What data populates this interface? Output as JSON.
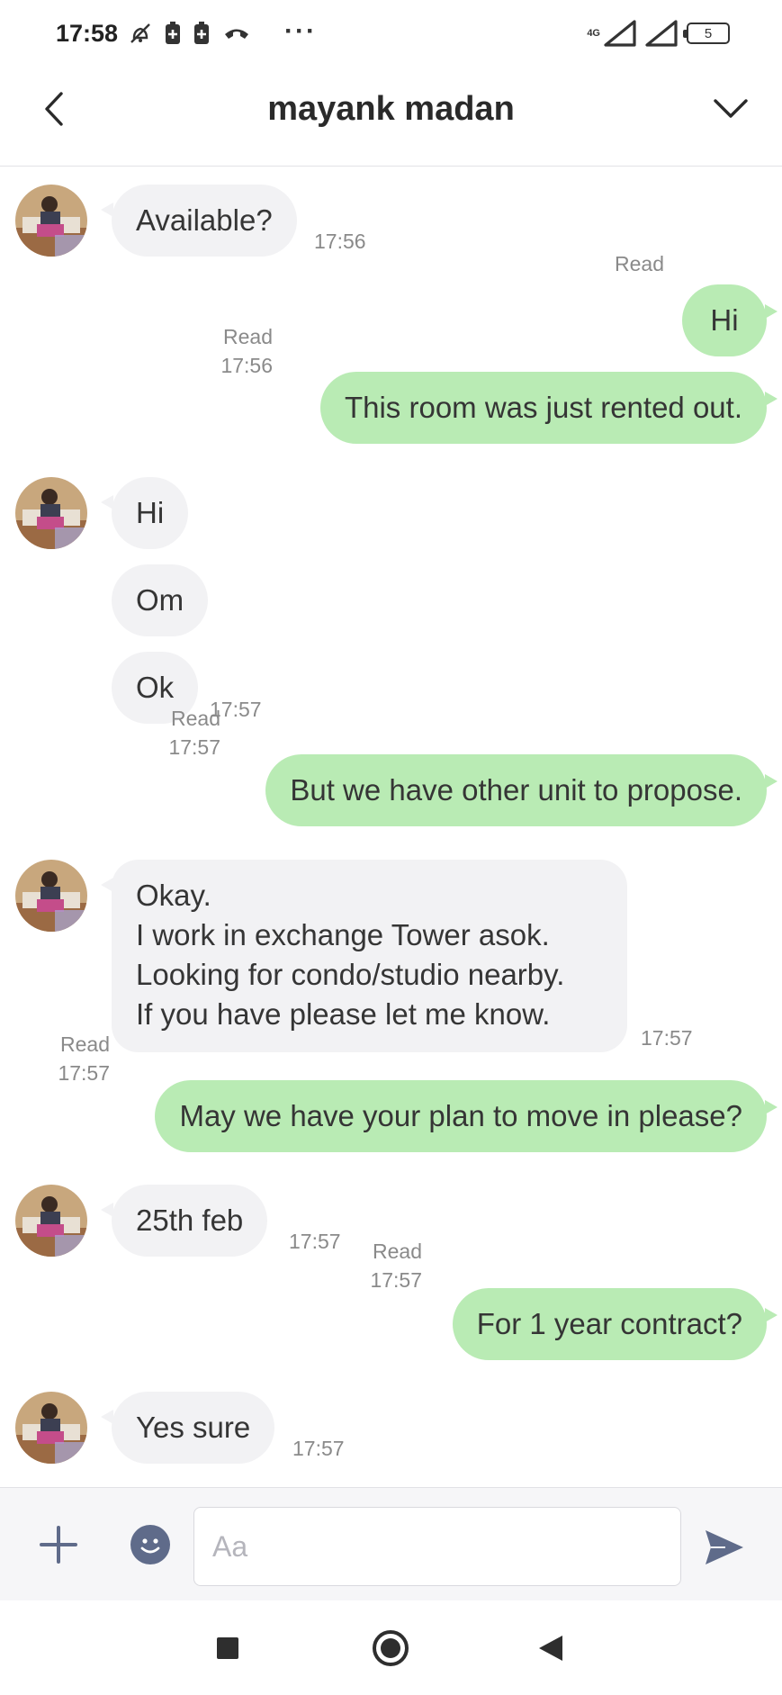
{
  "status_bar": {
    "time": "17:58",
    "dots": "···",
    "network": "4G",
    "battery": "5"
  },
  "header": {
    "title": "mayank madan"
  },
  "messages": [
    {
      "dir": "in",
      "text": "Available?",
      "time": "17:56"
    },
    {
      "dir": "out",
      "text": "Hi",
      "read": "Read"
    },
    {
      "dir": "out",
      "text": "This room was just rented out.",
      "read": "Read",
      "time": "17:56"
    },
    {
      "dir": "in",
      "text": "Hi"
    },
    {
      "dir": "in",
      "text": "Om"
    },
    {
      "dir": "in",
      "text": "Ok",
      "time": "17:57"
    },
    {
      "dir": "out",
      "text": "But we have other unit to propose.",
      "read": "Read",
      "time": "17:57"
    },
    {
      "dir": "in",
      "lines": [
        "Okay.",
        "I work in exchange Tower asok.",
        "Looking for condo/studio nearby.",
        "If you have please let me know."
      ],
      "time": "17:57"
    },
    {
      "dir": "out",
      "text": "May we have your plan to move in please?",
      "read": "Read",
      "time": "17:57"
    },
    {
      "dir": "in",
      "text": "25th feb",
      "time": "17:57"
    },
    {
      "dir": "out",
      "text": "For 1 year contract?",
      "read": "Read",
      "time": "17:57"
    },
    {
      "dir": "in",
      "text": "Yes sure",
      "time": "17:57"
    }
  ],
  "input": {
    "placeholder": "Aa"
  },
  "icons": {
    "back": "chevron-left-icon",
    "menu": "chevron-down-icon",
    "plus": "plus-icon",
    "emoji": "smiley-icon",
    "send": "send-icon",
    "nav_recent": "square-icon",
    "nav_home": "circle-icon",
    "nav_back": "triangle-back-icon"
  },
  "colors": {
    "outgoing_bubble": "#b9ebb4",
    "incoming_bubble": "#f2f2f4",
    "accent_icon": "#5f6b8a"
  }
}
